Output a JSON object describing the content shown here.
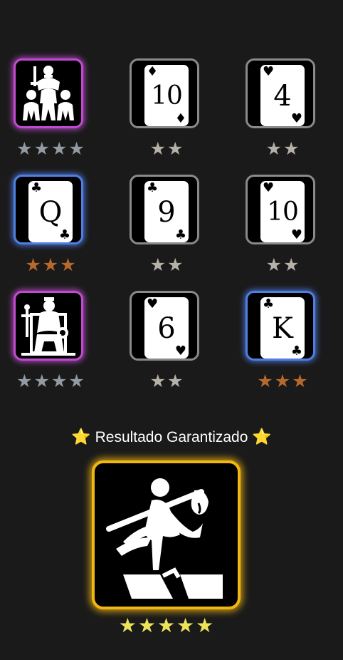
{
  "colors": {
    "background": "#1a1a1a",
    "rarity_common": "#8a8a8a",
    "rarity_rare": "#4f7fe0",
    "rarity_epic": "#c24ad0",
    "rarity_legendary": "#f2b70f",
    "star_gray": "#b5b0a8",
    "star_steel": "#939aa2",
    "star_bronze": "#b6692c",
    "star_gold": "#ede35a"
  },
  "grid": [
    {
      "type": "art",
      "art": "army-icon",
      "rarity": "purple",
      "rank": "",
      "suit": "",
      "stars": "★★★★",
      "star_count": 4,
      "star_color": "steel"
    },
    {
      "type": "card",
      "rank": "10",
      "suit": "♦",
      "rarity": "gray",
      "stars": "★★",
      "star_count": 2,
      "star_color": "gray"
    },
    {
      "type": "card",
      "rank": "4",
      "suit": "♥",
      "rarity": "gray",
      "stars": "★★",
      "star_count": 2,
      "star_color": "gray"
    },
    {
      "type": "card",
      "rank": "Q",
      "suit": "♣",
      "rarity": "blue",
      "stars": "★★★",
      "star_count": 3,
      "star_color": "bronze"
    },
    {
      "type": "card",
      "rank": "9",
      "suit": "♣",
      "rarity": "gray",
      "stars": "★★",
      "star_count": 2,
      "star_color": "gray"
    },
    {
      "type": "card",
      "rank": "10",
      "suit": "♥",
      "rarity": "gray",
      "stars": "★★",
      "star_count": 2,
      "star_color": "gray"
    },
    {
      "type": "art",
      "art": "enthroned-figure-icon",
      "rarity": "purple",
      "rank": "",
      "suit": "",
      "stars": "★★★★",
      "star_count": 4,
      "star_color": "steel"
    },
    {
      "type": "card",
      "rank": "6",
      "suit": "♥",
      "rarity": "gray",
      "stars": "★★",
      "star_count": 2,
      "star_color": "gray"
    },
    {
      "type": "card",
      "rank": "K",
      "suit": "♣",
      "rarity": "blue",
      "stars": "★★★",
      "star_count": 3,
      "star_color": "bronze"
    }
  ],
  "banner": {
    "left_star": "⭐",
    "text": "Resultado Garantizado",
    "right_star": "⭐"
  },
  "featured": {
    "art": "fool-wanderer-icon",
    "rarity": "gold",
    "stars": "★★★★★",
    "star_count": 5
  }
}
